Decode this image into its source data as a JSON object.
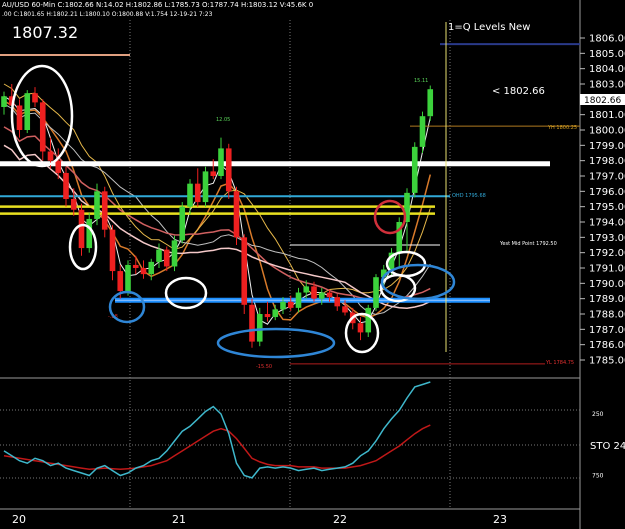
{
  "header": {
    "info_line1": "AU/USD 60-Min  C:1802.66  N:14.02  H:1802.86  L:1785.73  O:1787.74  H:1803.12  V:45.6K  0",
    "info_line2": ".00  C:1801.65  H:1802.21  L:1800.10  O:1800.88  V:1.754  12-19-21  7:23",
    "big_price": "1807.32",
    "indicator_title": "1=Q Levels New"
  },
  "annotations": {
    "price_tag": "< 1802.66",
    "last_price": "1802.66",
    "yh_label": "YH 1800.25",
    "ohd_label": "OHD 1795.68",
    "yest_mid": "Yest Mid Point 1792.50",
    "yl_label": "YL 1784.75",
    "swing_high_1": "12.05",
    "swing_high_2": "15.11",
    "swing_low_1": "-15.50",
    "swing_low_2": "-.88"
  },
  "osc": {
    "label": "STO 24",
    "ticks": [
      {
        "label": "250",
        "v": 250
      },
      {
        "label": "750",
        "v": 750
      }
    ]
  },
  "chart_data": {
    "type": "candlestick",
    "ylim": [
      1784.5,
      1806.8
    ],
    "y_ticks": [
      "1806.00",
      "1805.00",
      "1804.00",
      "1803.00",
      "1802.00",
      "1801.00",
      "1800.00",
      "1799.00",
      "1798.00",
      "1797.00",
      "1796.00",
      "1795.00",
      "1794.00",
      "1793.00",
      "1792.00",
      "1791.00",
      "1790.00",
      "1789.00",
      "1788.00",
      "1787.00",
      "1786.00",
      "1785.00"
    ],
    "x_tick_labels": [
      {
        "label": "20",
        "bar": 0
      },
      {
        "label": "21",
        "bar": 26
      },
      {
        "label": "22",
        "bar": 50
      },
      {
        "label": "23",
        "bar": 74
      }
    ],
    "candles": [
      [
        1801.5,
        1802.5,
        1801.0,
        1802.2
      ],
      [
        1802.2,
        1803.0,
        1801.8,
        1801.6
      ],
      [
        1801.6,
        1802.0,
        1799.5,
        1800.0
      ],
      [
        1800.0,
        1802.6,
        1799.8,
        1802.4
      ],
      [
        1802.4,
        1802.8,
        1801.5,
        1801.8
      ],
      [
        1801.8,
        1802.0,
        1798.0,
        1798.6
      ],
      [
        1798.6,
        1799.5,
        1797.5,
        1798.0
      ],
      [
        1798.0,
        1798.8,
        1796.8,
        1797.2
      ],
      [
        1797.2,
        1797.6,
        1795.0,
        1795.5
      ],
      [
        1795.5,
        1796.2,
        1794.4,
        1794.8
      ],
      [
        1794.8,
        1795.2,
        1791.8,
        1792.3
      ],
      [
        1792.3,
        1794.6,
        1792.0,
        1794.2
      ],
      [
        1794.2,
        1796.5,
        1793.8,
        1796.0
      ],
      [
        1796.0,
        1796.3,
        1793.0,
        1793.5
      ],
      [
        1793.5,
        1793.8,
        1790.2,
        1790.8
      ],
      [
        1790.8,
        1791.2,
        1789.0,
        1789.5
      ],
      [
        1789.5,
        1791.5,
        1789.2,
        1791.2
      ],
      [
        1791.2,
        1791.8,
        1790.6,
        1791.0
      ],
      [
        1791.0,
        1791.5,
        1790.3,
        1790.6
      ],
      [
        1790.6,
        1791.6,
        1790.2,
        1791.4
      ],
      [
        1791.4,
        1792.6,
        1791.0,
        1792.2
      ],
      [
        1792.2,
        1792.4,
        1790.8,
        1791.1
      ],
      [
        1791.1,
        1793.1,
        1790.8,
        1792.8
      ],
      [
        1792.8,
        1795.3,
        1792.6,
        1795.0
      ],
      [
        1795.0,
        1796.8,
        1794.5,
        1796.5
      ],
      [
        1796.5,
        1797.5,
        1795.0,
        1795.3
      ],
      [
        1795.3,
        1797.6,
        1795.0,
        1797.3
      ],
      [
        1797.3,
        1798.1,
        1796.8,
        1797.0
      ],
      [
        1797.0,
        1799.5,
        1796.8,
        1798.8
      ],
      [
        1798.8,
        1799.1,
        1795.5,
        1796.0
      ],
      [
        1796.0,
        1796.3,
        1792.5,
        1793.0
      ],
      [
        1793.0,
        1793.2,
        1788.0,
        1788.6
      ],
      [
        1788.6,
        1789.0,
        1785.8,
        1786.2
      ],
      [
        1786.2,
        1788.4,
        1785.9,
        1788.0
      ],
      [
        1788.0,
        1788.8,
        1787.5,
        1787.8
      ],
      [
        1787.8,
        1788.6,
        1787.6,
        1788.3
      ],
      [
        1788.3,
        1789.1,
        1788.0,
        1788.8
      ],
      [
        1788.8,
        1789.2,
        1788.2,
        1788.4
      ],
      [
        1788.4,
        1789.7,
        1788.1,
        1789.4
      ],
      [
        1789.4,
        1790.2,
        1789.0,
        1789.8
      ],
      [
        1789.8,
        1790.1,
        1788.8,
        1789.0
      ],
      [
        1789.0,
        1789.7,
        1788.6,
        1789.4
      ],
      [
        1789.4,
        1789.6,
        1788.8,
        1789.1
      ],
      [
        1789.1,
        1789.3,
        1788.2,
        1788.5
      ],
      [
        1788.5,
        1788.9,
        1787.9,
        1788.1
      ],
      [
        1788.1,
        1788.4,
        1787.0,
        1787.4
      ],
      [
        1787.4,
        1787.8,
        1786.3,
        1786.8
      ],
      [
        1786.8,
        1788.6,
        1786.5,
        1788.4
      ],
      [
        1788.4,
        1790.6,
        1788.2,
        1790.4
      ],
      [
        1790.4,
        1791.2,
        1789.8,
        1790.9
      ],
      [
        1790.9,
        1792.3,
        1790.5,
        1792.0
      ],
      [
        1792.0,
        1794.3,
        1791.0,
        1794.0
      ],
      [
        1794.0,
        1796.2,
        1792.0,
        1795.9
      ],
      [
        1795.9,
        1799.2,
        1795.6,
        1798.9
      ],
      [
        1798.9,
        1801.2,
        1798.5,
        1800.9
      ],
      [
        1800.9,
        1802.9,
        1800.6,
        1802.66
      ]
    ],
    "levels": [
      {
        "name": "Top Level",
        "value": 1805.6
      },
      {
        "name": "YH",
        "value": 1800.25
      },
      {
        "name": "Key Level",
        "value": 1797.8
      },
      {
        "name": "OHD",
        "value": 1795.68
      },
      {
        "name": "Yest Mid Point",
        "value": 1792.5
      },
      {
        "name": "Support Zone",
        "value": 1788.9
      },
      {
        "name": "YL",
        "value": 1784.75
      }
    ],
    "osc_series": {
      "fast": [
        560,
        600,
        640,
        660,
        620,
        640,
        680,
        660,
        700,
        720,
        740,
        760,
        700,
        680,
        720,
        760,
        740,
        700,
        680,
        640,
        620,
        560,
        480,
        400,
        360,
        300,
        240,
        200,
        260,
        420,
        660,
        760,
        780,
        700,
        690,
        700,
        690,
        700,
        720,
        710,
        700,
        720,
        710,
        700,
        690,
        660,
        600,
        560,
        480,
        380,
        300,
        230,
        130,
        40,
        20,
        0
      ],
      "slow": [
        600,
        610,
        620,
        630,
        640,
        650,
        660,
        670,
        680,
        690,
        700,
        710,
        705,
        700,
        705,
        710,
        705,
        700,
        690,
        680,
        660,
        640,
        600,
        560,
        520,
        480,
        440,
        400,
        380,
        400,
        460,
        540,
        620,
        650,
        670,
        680,
        680,
        680,
        690,
        690,
        690,
        700,
        700,
        700,
        700,
        690,
        680,
        660,
        640,
        600,
        560,
        520,
        470,
        420,
        380,
        350
      ]
    },
    "osc_ylim": [
      0,
      1000
    ]
  }
}
